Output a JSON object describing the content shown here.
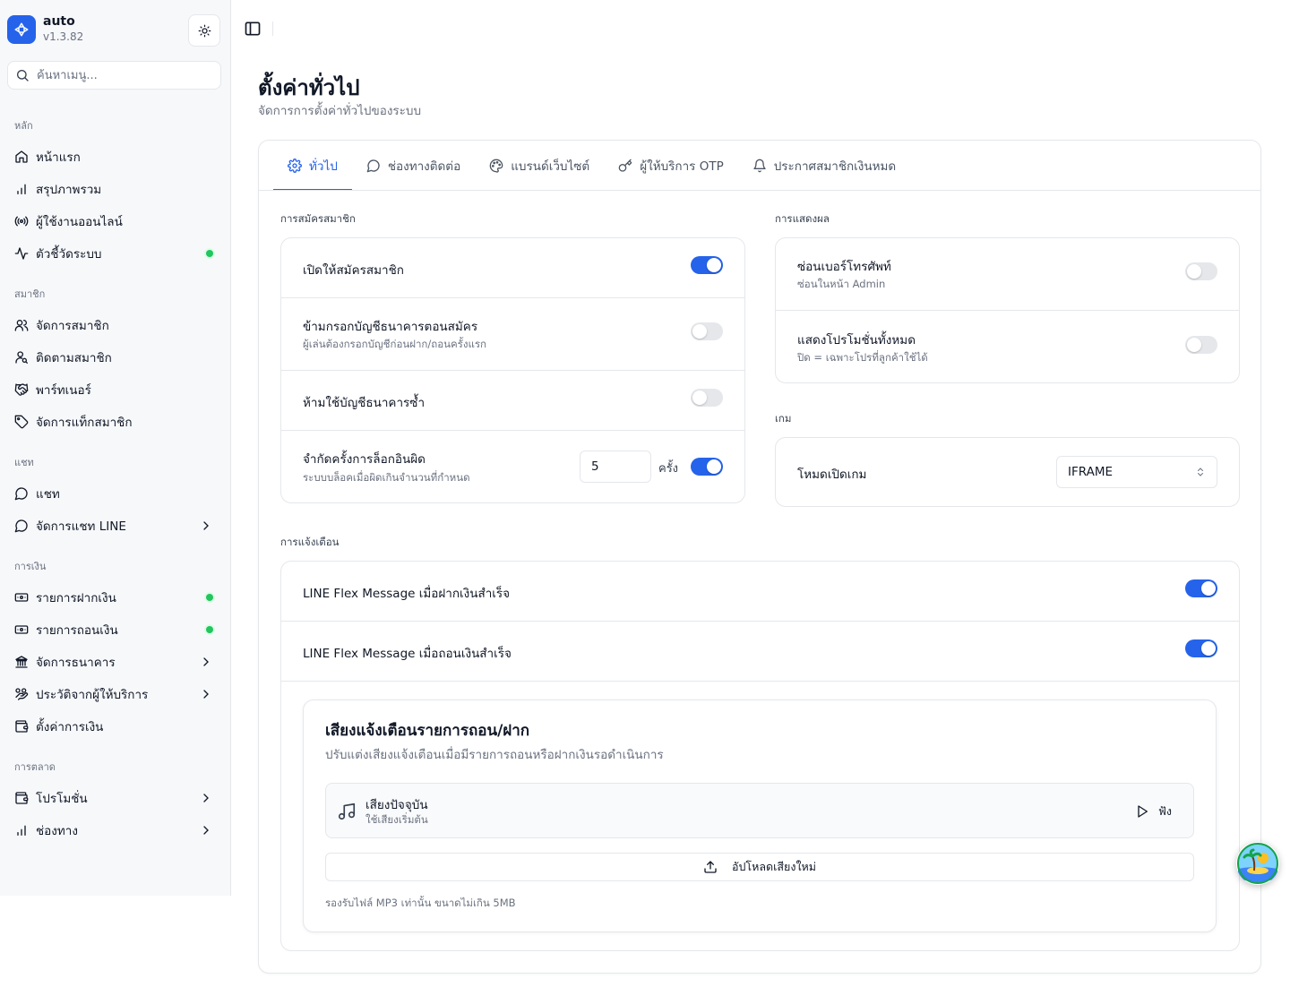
{
  "app": {
    "name": "auto",
    "version": "v1.3.82"
  },
  "search": {
    "placeholder": "ค้นหาเมนู..."
  },
  "sidebar": {
    "sections": [
      {
        "label": "หลัก",
        "items": [
          {
            "label": "หน้าแรก",
            "icon": "home-icon"
          },
          {
            "label": "สรุปภาพรวม",
            "icon": "bar-chart-icon"
          },
          {
            "label": "ผู้ใช้งานออนไลน์",
            "icon": "radio-icon"
          },
          {
            "label": "ตัวชี้วัดระบบ",
            "icon": "activity-icon",
            "status": "online"
          }
        ]
      },
      {
        "label": "สมาชิก",
        "items": [
          {
            "label": "จัดการสมาชิก",
            "icon": "users-icon"
          },
          {
            "label": "ติดตามสมาชิก",
            "icon": "user-search-icon"
          },
          {
            "label": "พาร์ทเนอร์",
            "icon": "handshake-icon"
          },
          {
            "label": "จัดการแท็กสมาชิก",
            "icon": "tag-icon"
          }
        ]
      },
      {
        "label": "แชท",
        "items": [
          {
            "label": "แชท",
            "icon": "message-circle-icon"
          },
          {
            "label": "จัดการแชท LINE",
            "icon": "message-circle-icon",
            "expandable": true
          }
        ]
      },
      {
        "label": "การเงิน",
        "items": [
          {
            "label": "รายการฝากเงิน",
            "icon": "banknote-icon",
            "status": "online"
          },
          {
            "label": "รายการถอนเงิน",
            "icon": "banknote-icon",
            "status": "online"
          },
          {
            "label": "จัดการธนาคาร",
            "icon": "bank-icon",
            "expandable": true
          },
          {
            "label": "ประวัติจากผู้ให้บริการ",
            "icon": "history-icon",
            "expandable": true
          },
          {
            "label": "ตั้งค่าการเงิน",
            "icon": "wallet-icon"
          }
        ]
      },
      {
        "label": "การตลาด",
        "items": [
          {
            "label": "โปรโมชั่น",
            "icon": "wallet-icon",
            "expandable": true
          },
          {
            "label": "ช่องทาง",
            "icon": "bar-chart-icon",
            "expandable": true
          }
        ]
      }
    ]
  },
  "page": {
    "title": "ตั้งค่าทั่วไป",
    "subtitle": "จัดการการตั้งค่าทั่วไปของระบบ"
  },
  "tabs": [
    {
      "label": "ทั่วไป",
      "icon": "gear-icon",
      "active": true
    },
    {
      "label": "ช่องทางติดต่อ",
      "icon": "message-circle-icon"
    },
    {
      "label": "แบรนด์เว็บไซต์",
      "icon": "palette-icon"
    },
    {
      "label": "ผู้ให้บริการ OTP",
      "icon": "key-icon"
    },
    {
      "label": "ประกาศสมาชิกเงินหมด",
      "icon": "bell-icon"
    }
  ],
  "registration": {
    "label": "การสมัครสมาชิก",
    "open_signup": {
      "title": "เปิดให้สมัครสมาชิก",
      "enabled": true
    },
    "skip_bank": {
      "title": "ข้ามกรอกบัญชีธนาคารตอนสมัคร",
      "desc": "ผู้เล่นต้องกรอกบัญชีก่อนฝาก/ถอนครั้งแรก",
      "enabled": false
    },
    "no_duplicate_bank": {
      "title": "ห้ามใช้บัญชีธนาคารซ้ำ",
      "enabled": false
    },
    "login_limit": {
      "title": "จำกัดครั้งการล็อกอินผิด",
      "desc": "ระบบบล็อคเมื่อผิดเกินจำนวนที่กำหนด",
      "value": "5",
      "unit": "ครั้ง",
      "enabled": true
    }
  },
  "display": {
    "label": "การแสดงผล",
    "hide_phone": {
      "title": "ซ่อนเบอร์โทรศัพท์",
      "desc": "ซ่อนในหน้า Admin",
      "enabled": false
    },
    "show_all_promos": {
      "title": "แสดงโปรโมชั่นทั้งหมด",
      "desc": "ปิด = เฉพาะโปรที่ลูกค้าใช้ได้",
      "enabled": false
    }
  },
  "game": {
    "label": "เกม",
    "open_mode": {
      "title": "โหมดเปิดเกม",
      "value": "IFRAME"
    }
  },
  "notifications": {
    "label": "การแจ้งเตือน",
    "deposit_flex": {
      "title": "LINE Flex Message เมื่อฝากเงินสำเร็จ",
      "enabled": true
    },
    "withdraw_flex": {
      "title": "LINE Flex Message เมื่อถอนเงินสำเร็จ",
      "enabled": true
    },
    "sound": {
      "title": "เสียงแจ้งเตือนรายการถอน/ฝาก",
      "desc": "ปรับแต่งเสียงแจ้งเตือนเมื่อมีรายการถอนหรือฝากเงินรอดำเนินการ",
      "current_title": "เสียงปัจจุบัน",
      "current_sub": "ใช้เสียงเริ่มต้น",
      "play_label": "ฟัง",
      "upload_label": "อัปโหลดเสียงใหม่",
      "note": "รองรับไฟล์ MP3 เท่านั้น ขนาดไม่เกิน 5MB"
    }
  },
  "colors": {
    "primary": "#2563eb",
    "status_online": "#22c55e"
  }
}
